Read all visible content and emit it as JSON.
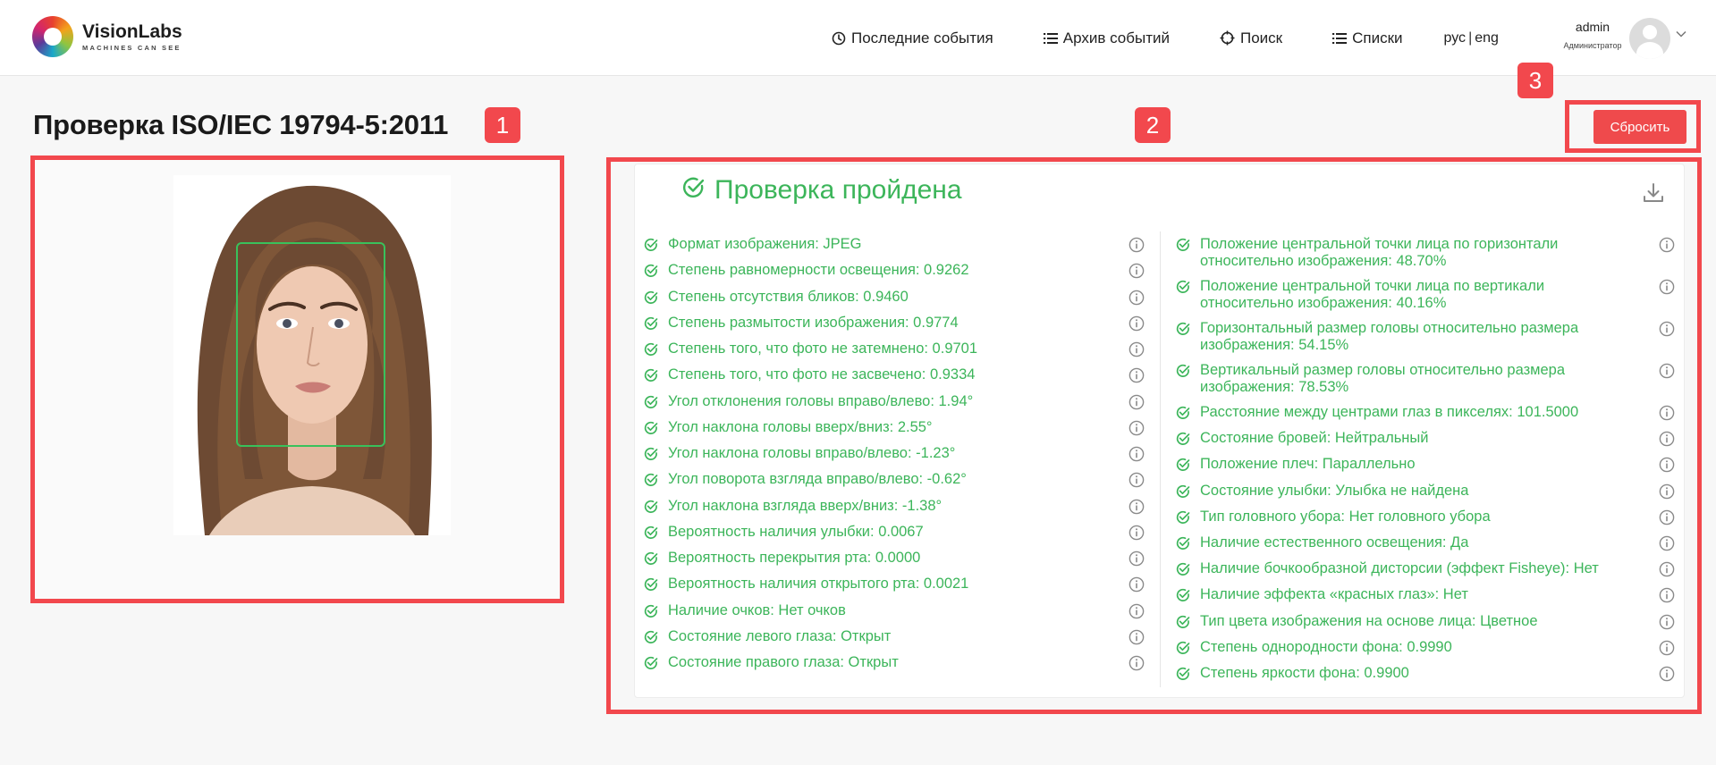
{
  "header": {
    "logo_name": "VisionLabs",
    "logo_tag": "MACHINES CAN SEE",
    "nav": [
      {
        "label": "Последние события",
        "icon": "clock-icon"
      },
      {
        "label": "Архив событий",
        "icon": "list-icon"
      },
      {
        "label": "Поиск",
        "icon": "crosshair-icon"
      },
      {
        "label": "Списки",
        "icon": "list-icon"
      }
    ],
    "lang_ru": "рус",
    "lang_en": "eng",
    "user_name": "admin",
    "user_role": "Администратор"
  },
  "page": {
    "title": "Проверка ISO/IEC 19794-5:2011",
    "reset_label": "Сбросить",
    "badges": [
      "1",
      "2",
      "3"
    ]
  },
  "result": {
    "title": "Проверка пройдена",
    "status_color": "#3cb55a",
    "accent_color": "#f2484d",
    "left_checks": [
      "Формат изображения: JPEG",
      "Степень равномерности освещения: 0.9262",
      "Степень отсутствия бликов: 0.9460",
      "Степень размытости изображения: 0.9774",
      "Степень того, что фото не затемнено: 0.9701",
      "Степень того, что фото не засвечено: 0.9334",
      "Угол отклонения головы вправо/влево: 1.94°",
      "Угол наклона головы вверх/вниз: 2.55°",
      "Угол наклона головы вправо/влево: -1.23°",
      "Угол поворота взгляда вправо/влево: -0.62°",
      "Угол наклона взгляда вверх/вниз: -1.38°",
      "Вероятность наличия улыбки: 0.0067",
      "Вероятность перекрытия рта: 0.0000",
      "Вероятность наличия открытого рта: 0.0021",
      "Наличие очков: Нет очков",
      "Состояние левого глаза: Открыт",
      "Состояние правого глаза: Открыт"
    ],
    "right_checks": [
      [
        "Положение центральной точки лица по горизонтали",
        "относительно изображения: 48.70%"
      ],
      [
        "Положение центральной точки лица по вертикали",
        "относительно изображения: 40.16%"
      ],
      [
        "Горизонтальный размер головы относительно размера",
        "изображения: 54.15%"
      ],
      [
        "Вертикальный размер головы относительно размера",
        "изображения: 78.53%"
      ],
      [
        "Расстояние между центрами глаз в пикселях: 101.5000"
      ],
      [
        "Состояние бровей: Нейтральный"
      ],
      [
        "Положение плеч: Параллельно"
      ],
      [
        "Состояние улыбки: Улыбка не найдена"
      ],
      [
        "Тип головного убора: Нет головного убора"
      ],
      [
        "Наличие естественного освещения: Да"
      ],
      [
        "Наличие бочкообразной дисторсии (эффект Fisheye): Нет"
      ],
      [
        "Наличие эффекта «красных глаз»: Нет"
      ],
      [
        "Тип цвета изображения на основе лица: Цветное"
      ],
      [
        "Степень однородности фона: 0.9990"
      ],
      [
        "Степень яркости фона: 0.9900"
      ]
    ]
  }
}
